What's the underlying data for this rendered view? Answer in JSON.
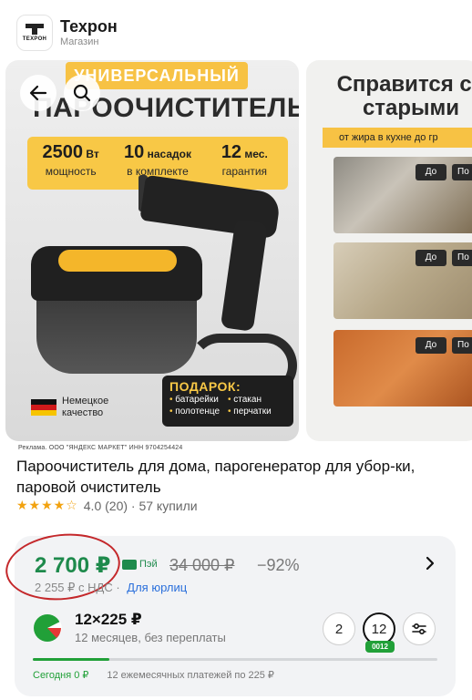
{
  "store": {
    "logo_text": "ТЕХРОН",
    "name": "Техрон",
    "type": "Магазин"
  },
  "gallery": {
    "slide1": {
      "badge": "УНИВЕРСАЛЬНЫЙ",
      "title": "ПАРООЧИСТИТЕЛЬ",
      "specs": [
        {
          "value": "2500",
          "unit": "Вт",
          "caption": "мощность"
        },
        {
          "value": "10",
          "unit": "насадок",
          "caption": "в комплекте"
        },
        {
          "value": "12",
          "unit": "мес.",
          "caption": "гарантия"
        }
      ],
      "origin": "Немецкое качество",
      "gift_title": "ПОДАРОК:",
      "gifts": [
        "батарейки",
        "стакан",
        "полотенце",
        "перчатки"
      ]
    },
    "slide2": {
      "title": "Справится со старыми",
      "subtitle": "от жира в кухне до гр",
      "before_label": "До",
      "after_label": "По"
    }
  },
  "product": {
    "ad_note": "Реклама. ООО \"ЯНДЕКС МАРКЕТ\" ИНН 9704254424",
    "title": "Пароочиститель для дома, парогенератор для убор-ки, паровой очиститель",
    "stars": "★★★★☆",
    "rating": "4.0 (20) · 57 купили"
  },
  "price": {
    "current": "2 700 ₽",
    "pay_label": "Пэй",
    "old": "34 000 ₽",
    "discount": "−92%",
    "vat_text": "2 255 ₽ с НДС ·",
    "vat_link": "Для юрлиц"
  },
  "installment": {
    "amount": "12×225 ₽",
    "description": "12 месяцев, без переплаты",
    "terms": [
      "2",
      "12"
    ],
    "selected_badge": "0012",
    "progress_fraction": 0.19,
    "today_label": "Сегодня 0 ₽",
    "schedule_label": "12 ежемесячных платежей по 225 ₽"
  },
  "colors": {
    "accent_yellow": "#f8c846",
    "price_green": "#1e8a4c",
    "installment_green": "#21a038",
    "link_blue": "#2a6fdb",
    "annotation_red": "#c4282b"
  }
}
